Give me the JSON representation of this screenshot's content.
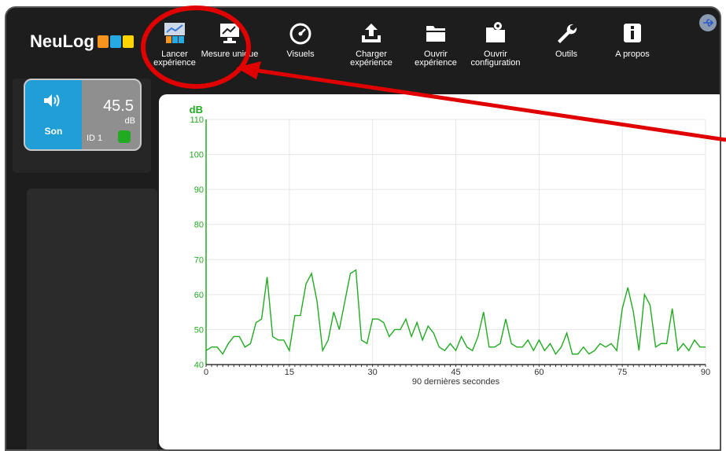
{
  "app": {
    "logo_text": "NeuLog",
    "logo_colors": [
      "#f7941d",
      "#27aae1",
      "#ffd400"
    ]
  },
  "toolbar": [
    {
      "line1": "Lancer",
      "line2": "expérience",
      "icon": "start-experiment-icon"
    },
    {
      "line1": "Mesure unique",
      "line2": "",
      "icon": "single-measure-icon"
    },
    {
      "line1": "Visuels",
      "line2": "",
      "icon": "gauge-icon"
    },
    {
      "line1": "Charger",
      "line2": "expérience",
      "icon": "upload-icon"
    },
    {
      "line1": "Ouvrir",
      "line2": "expérience",
      "icon": "folder-icon"
    },
    {
      "line1": "Ouvrir",
      "line2": "configuration",
      "icon": "folder-gear-icon"
    },
    {
      "line1": "Outils",
      "line2": "",
      "icon": "wrench-icon"
    },
    {
      "line1": "A propos",
      "line2": "",
      "icon": "info-icon"
    }
  ],
  "sensor": {
    "name": "Son",
    "value": "45.5",
    "unit": "dB",
    "id_label": "ID 1",
    "status_color": "#22aa22"
  },
  "chart_data": {
    "type": "line",
    "ylabel": "dB",
    "xlabel": "90 dernières secondes",
    "xlim": [
      0,
      90
    ],
    "ylim": [
      40,
      110
    ],
    "x_ticks": [
      0,
      15,
      30,
      45,
      60,
      75,
      90
    ],
    "y_ticks": [
      40,
      50,
      60,
      70,
      80,
      90,
      100,
      110
    ],
    "series": [
      {
        "color": "#22aa22",
        "values": [
          44,
          45,
          45,
          43,
          46,
          48,
          48,
          45,
          46,
          52,
          53,
          65,
          48,
          47,
          47,
          44,
          54,
          54,
          63,
          66,
          58,
          44,
          47,
          55,
          50,
          58,
          66,
          67,
          47,
          46,
          53,
          53,
          52,
          48,
          50,
          50,
          53,
          48,
          52,
          47,
          51,
          49,
          45,
          44,
          46,
          44,
          48,
          45,
          44,
          48,
          55,
          45,
          45,
          46,
          53,
          46,
          45,
          45,
          47,
          44,
          47,
          44,
          46,
          43,
          45,
          49,
          43,
          43,
          45,
          43,
          44,
          46,
          45,
          46,
          44,
          56,
          62,
          55,
          44,
          60,
          57,
          45,
          46,
          46,
          56,
          44,
          46,
          44,
          47,
          45,
          45
        ]
      }
    ]
  }
}
